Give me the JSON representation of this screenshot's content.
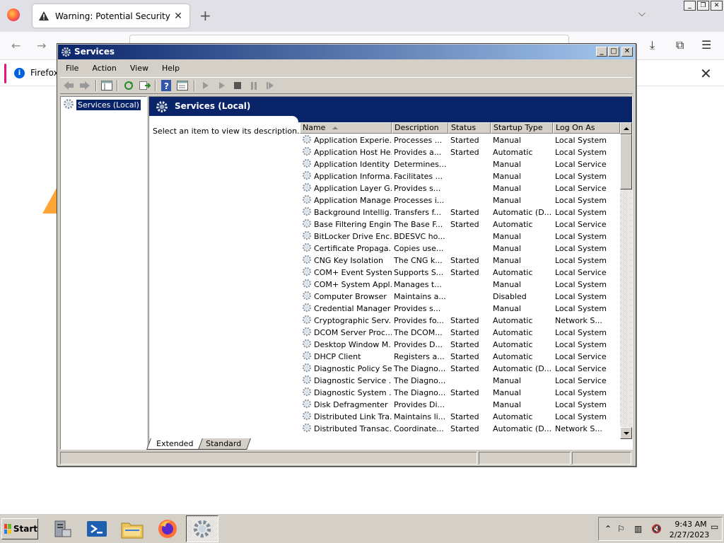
{
  "browser": {
    "tab_title": "Warning: Potential Security Risk Ah",
    "infobar_text": "Firefox"
  },
  "window": {
    "title": "Services",
    "menu": [
      "File",
      "Action",
      "View",
      "Help"
    ]
  },
  "tree": {
    "root": "Services (Local)"
  },
  "panel": {
    "header": "Services (Local)",
    "description": "Select an item to view its description."
  },
  "columns": [
    "Name",
    "Description",
    "Status",
    "Startup Type",
    "Log On As"
  ],
  "services": [
    {
      "name": "Application Experie...",
      "desc": "Processes ...",
      "status": "Started",
      "startup": "Manual",
      "logon": "Local System"
    },
    {
      "name": "Application Host He...",
      "desc": "Provides a...",
      "status": "Started",
      "startup": "Automatic",
      "logon": "Local System"
    },
    {
      "name": "Application Identity",
      "desc": "Determines...",
      "status": "",
      "startup": "Manual",
      "logon": "Local Service"
    },
    {
      "name": "Application Informa...",
      "desc": "Facilitates ...",
      "status": "",
      "startup": "Manual",
      "logon": "Local System"
    },
    {
      "name": "Application Layer G...",
      "desc": "Provides s...",
      "status": "",
      "startup": "Manual",
      "logon": "Local Service"
    },
    {
      "name": "Application Manage...",
      "desc": "Processes i...",
      "status": "",
      "startup": "Manual",
      "logon": "Local System"
    },
    {
      "name": "Background Intellig...",
      "desc": "Transfers f...",
      "status": "Started",
      "startup": "Automatic (D...",
      "logon": "Local System"
    },
    {
      "name": "Base Filtering Engine",
      "desc": "The Base F...",
      "status": "Started",
      "startup": "Automatic",
      "logon": "Local Service"
    },
    {
      "name": "BitLocker Drive Enc...",
      "desc": "BDESVC ho...",
      "status": "",
      "startup": "Manual",
      "logon": "Local System"
    },
    {
      "name": "Certificate Propaga...",
      "desc": "Copies use...",
      "status": "",
      "startup": "Manual",
      "logon": "Local System"
    },
    {
      "name": "CNG Key Isolation",
      "desc": "The CNG k...",
      "status": "Started",
      "startup": "Manual",
      "logon": "Local System"
    },
    {
      "name": "COM+ Event System",
      "desc": "Supports S...",
      "status": "Started",
      "startup": "Automatic",
      "logon": "Local Service"
    },
    {
      "name": "COM+ System Appl...",
      "desc": "Manages t...",
      "status": "",
      "startup": "Manual",
      "logon": "Local System"
    },
    {
      "name": "Computer Browser",
      "desc": "Maintains a...",
      "status": "",
      "startup": "Disabled",
      "logon": "Local System"
    },
    {
      "name": "Credential Manager",
      "desc": "Provides s...",
      "status": "",
      "startup": "Manual",
      "logon": "Local System"
    },
    {
      "name": "Cryptographic Serv...",
      "desc": "Provides fo...",
      "status": "Started",
      "startup": "Automatic",
      "logon": "Network S..."
    },
    {
      "name": "DCOM Server Proc...",
      "desc": "The DCOM...",
      "status": "Started",
      "startup": "Automatic",
      "logon": "Local System"
    },
    {
      "name": "Desktop Window M...",
      "desc": "Provides D...",
      "status": "Started",
      "startup": "Automatic",
      "logon": "Local System"
    },
    {
      "name": "DHCP Client",
      "desc": "Registers a...",
      "status": "Started",
      "startup": "Automatic",
      "logon": "Local Service"
    },
    {
      "name": "Diagnostic Policy Se...",
      "desc": "The Diagno...",
      "status": "Started",
      "startup": "Automatic (D...",
      "logon": "Local Service"
    },
    {
      "name": "Diagnostic Service ...",
      "desc": "The Diagno...",
      "status": "",
      "startup": "Manual",
      "logon": "Local Service"
    },
    {
      "name": "Diagnostic System ...",
      "desc": "The Diagno...",
      "status": "Started",
      "startup": "Manual",
      "logon": "Local System"
    },
    {
      "name": "Disk Defragmenter",
      "desc": "Provides Di...",
      "status": "",
      "startup": "Manual",
      "logon": "Local System"
    },
    {
      "name": "Distributed Link Tra...",
      "desc": "Maintains li...",
      "status": "Started",
      "startup": "Automatic",
      "logon": "Local System"
    },
    {
      "name": "Distributed Transac...",
      "desc": "Coordinate...",
      "status": "Started",
      "startup": "Automatic (D...",
      "logon": "Network S..."
    }
  ],
  "view_tabs": [
    "Extended",
    "Standard"
  ],
  "taskbar": {
    "start": "Start",
    "time": "9:43 AM",
    "date": "2/27/2023"
  },
  "colors": {
    "titlebar": "#0a246a",
    "selection": "#0a246a",
    "chrome": "#d4d0c8",
    "firefox_accent": "#e31587"
  }
}
